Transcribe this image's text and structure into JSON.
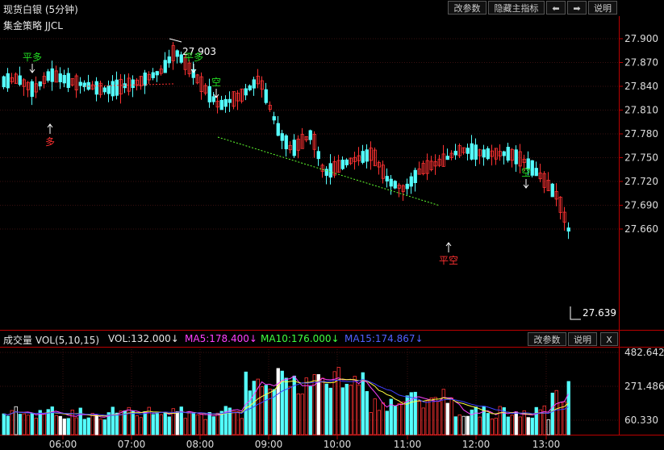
{
  "header": {
    "title": "现货白银 (5分钟)",
    "buttons": [
      "改参数",
      "隐藏主指标",
      "⬅",
      "➡",
      "说明"
    ]
  },
  "strategy": "集金策略 JJCL",
  "price_axis": [
    "27.900",
    "27.870",
    "27.840",
    "27.810",
    "27.780",
    "27.750",
    "27.720",
    "27.690",
    "27.660"
  ],
  "time_axis": [
    "06:00",
    "07:00",
    "08:00",
    "09:00",
    "10:00",
    "11:00",
    "12:00",
    "13:00"
  ],
  "annotations": {
    "high_label": "27.903",
    "low_label": "27.639",
    "signals": [
      {
        "text": "平多",
        "type": "close-long"
      },
      {
        "text": "多",
        "type": "long"
      },
      {
        "text": "平多",
        "type": "close-long"
      },
      {
        "text": "空",
        "type": "short"
      },
      {
        "text": "平空",
        "type": "close-short"
      },
      {
        "text": "空",
        "type": "short"
      }
    ]
  },
  "volume": {
    "label": "成交量 VOL(5,10,15)",
    "vol": "VOL:132.000↓",
    "ma5": "MA5:178.400↓",
    "ma10": "MA10:176.000↓",
    "ma15": "MA15:174.867↓",
    "buttons": [
      "改参数",
      "说明",
      "X"
    ],
    "axis": [
      "482.642",
      "271.486",
      "60.330"
    ]
  },
  "colors": {
    "up": "#ff3232",
    "down": "#54ffff",
    "ma5": "#ff40ff",
    "ma10": "#ffff40",
    "ma15": "#4040ff",
    "signal_green": "#22dd22",
    "signal_red": "#ff3030"
  }
}
